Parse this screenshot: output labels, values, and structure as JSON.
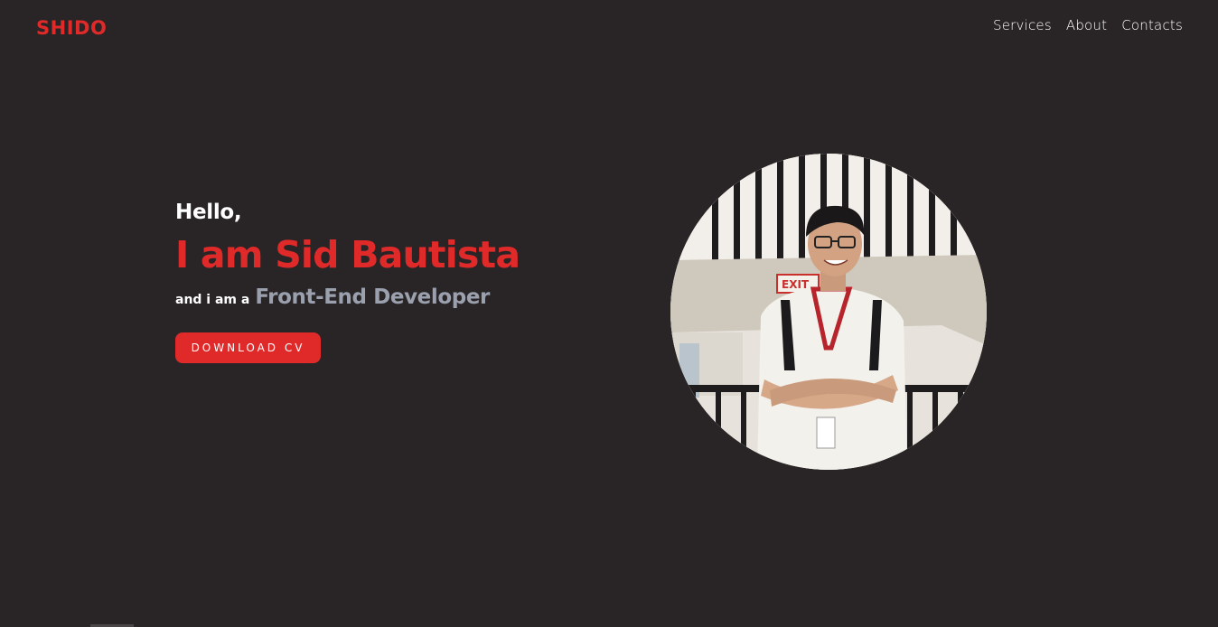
{
  "brand": {
    "logo": "SHIDO"
  },
  "nav": {
    "items": [
      "Services",
      "About",
      "Contacts"
    ]
  },
  "hero": {
    "greeting": "Hello,",
    "name": "I am Sid Bautista",
    "role_prefix": "and i am a",
    "role": "Front-End Developer",
    "cta": "DOWNLOAD CV"
  },
  "colors": {
    "background": "#292526",
    "accent": "#e02a2a",
    "muted": "#9aa0ad",
    "text": "#ffffff"
  },
  "icons": [
    "profile-photo"
  ]
}
